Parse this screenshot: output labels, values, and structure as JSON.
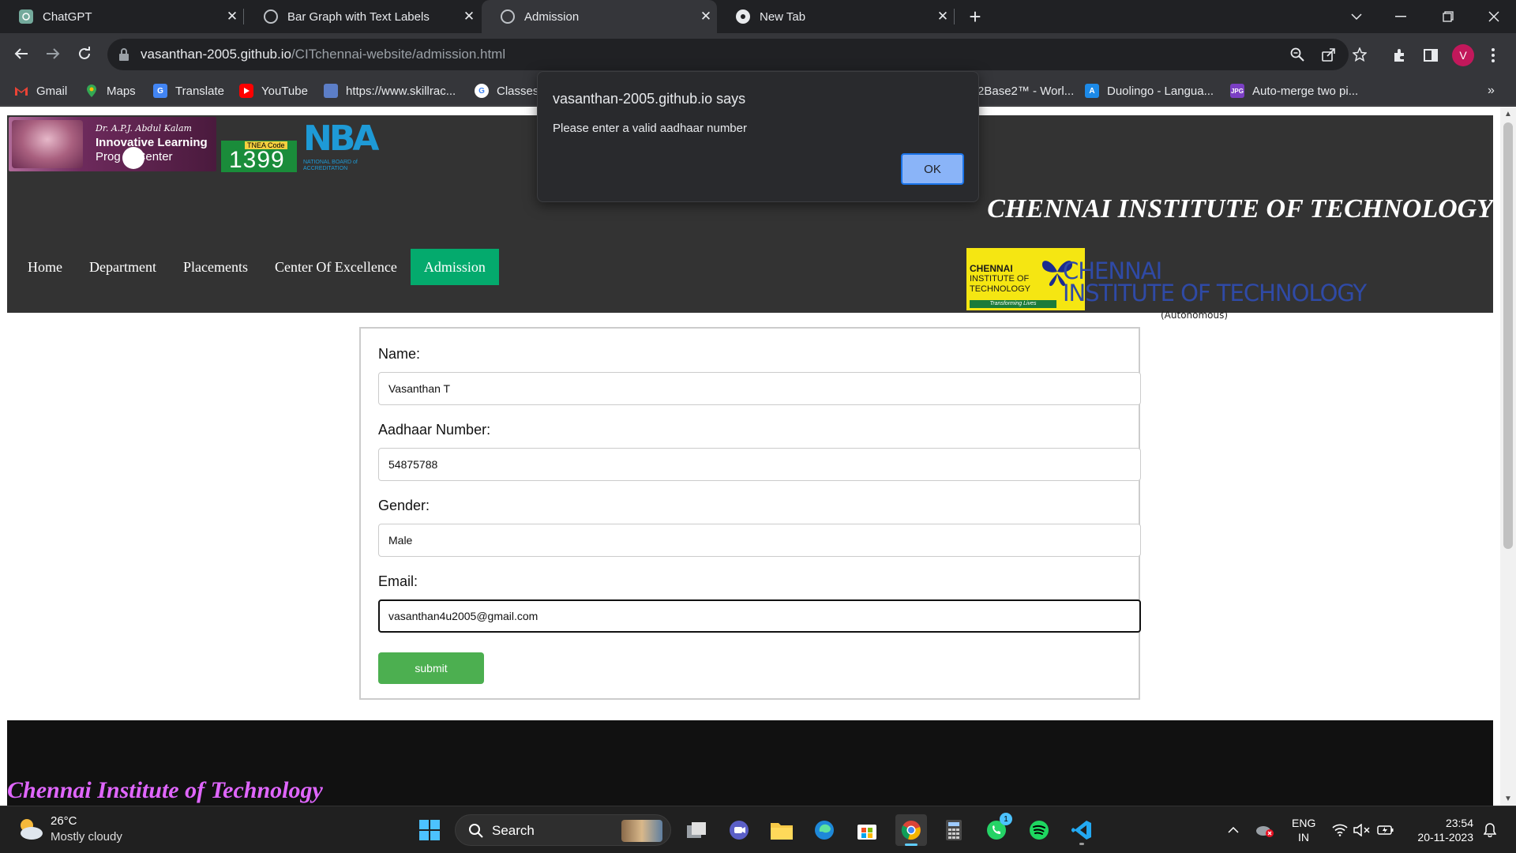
{
  "browser": {
    "tabs": [
      {
        "label": "ChatGPT",
        "active": false
      },
      {
        "label": "Bar Graph with Text Labels",
        "active": false
      },
      {
        "label": "Admission",
        "active": true
      },
      {
        "label": "New Tab",
        "active": false
      }
    ],
    "url_host": "vasanthan-2005.github.io",
    "url_path": "/CITchennai-website/admission.html",
    "profile_initial": "V",
    "bookmarks": [
      {
        "label": "Gmail",
        "icon": "gmail-icon"
      },
      {
        "label": "Maps",
        "icon": "maps-icon"
      },
      {
        "label": "Translate",
        "icon": "translate-icon"
      },
      {
        "label": "YouTube",
        "icon": "youtube-icon"
      },
      {
        "label": "https://www.skillrac...",
        "icon": "skillrack-icon"
      },
      {
        "label": "Classes",
        "icon": "google-icon"
      },
      {
        "label": "2Base2™ - Worl...",
        "icon": "base-icon"
      },
      {
        "label": "Duolingo - Langua...",
        "icon": "duolingo-icon"
      },
      {
        "label": "Auto-merge two pi...",
        "icon": "jpg-icon"
      }
    ]
  },
  "dialog": {
    "title": "vasanthan-2005.github.io says",
    "message": "Please enter a valid aadhaar number",
    "ok_label": "OK"
  },
  "page": {
    "header": {
      "kalam_sig": "Dr. A.P.J. Abdul Kalam",
      "kalam_line1": "Innovative Learning",
      "kalam_line2": "Prog     Center",
      "tnea_code_label": "TNEA Code",
      "tnea_code": "1399",
      "nba_text": "NBA",
      "nba_sub": "NATIONAL BOARD of ACCREDITATION",
      "site_title": "CHENNAI INSTITUTE OF TECHNOLOGY",
      "logo_line1": "CHENNAI",
      "logo_line2": "INSTITUTE OF",
      "logo_line3": "TECHNOLOGY",
      "logo_tagline": "Transforming Lives",
      "inst_name1": "CHENNAI",
      "inst_name2": "INSTITUTE OF TECHNOLOGY",
      "inst_autonomous": "(Autonomous)"
    },
    "nav": [
      {
        "label": "Home",
        "active": false
      },
      {
        "label": "Department",
        "active": false
      },
      {
        "label": "Placements",
        "active": false
      },
      {
        "label": "Center Of Excellence",
        "active": false
      },
      {
        "label": "Admission",
        "active": true
      }
    ],
    "form": {
      "name_label": "Name:",
      "name_value": "Vasanthan T",
      "aadhaar_label": "Aadhaar Number:",
      "aadhaar_value": "54875788",
      "gender_label": "Gender:",
      "gender_value": "Male",
      "email_label": "Email:",
      "email_value": "vasanthan4u2005@gmail.com",
      "submit_label": "submit"
    },
    "footer_title": "Chennai Institute of Technology"
  },
  "taskbar": {
    "temperature": "26°C",
    "weather": "Mostly cloudy",
    "search_label": "Search",
    "lang1": "ENG",
    "lang2": "IN",
    "time": "23:54",
    "date": "20-11-2023",
    "whatsapp_badge": "1"
  },
  "colors": {
    "accent_nav": "#04aa6d",
    "submit": "#4caf50",
    "footer_text": "#e066ff",
    "dialog_button": "#8ab4f8"
  }
}
